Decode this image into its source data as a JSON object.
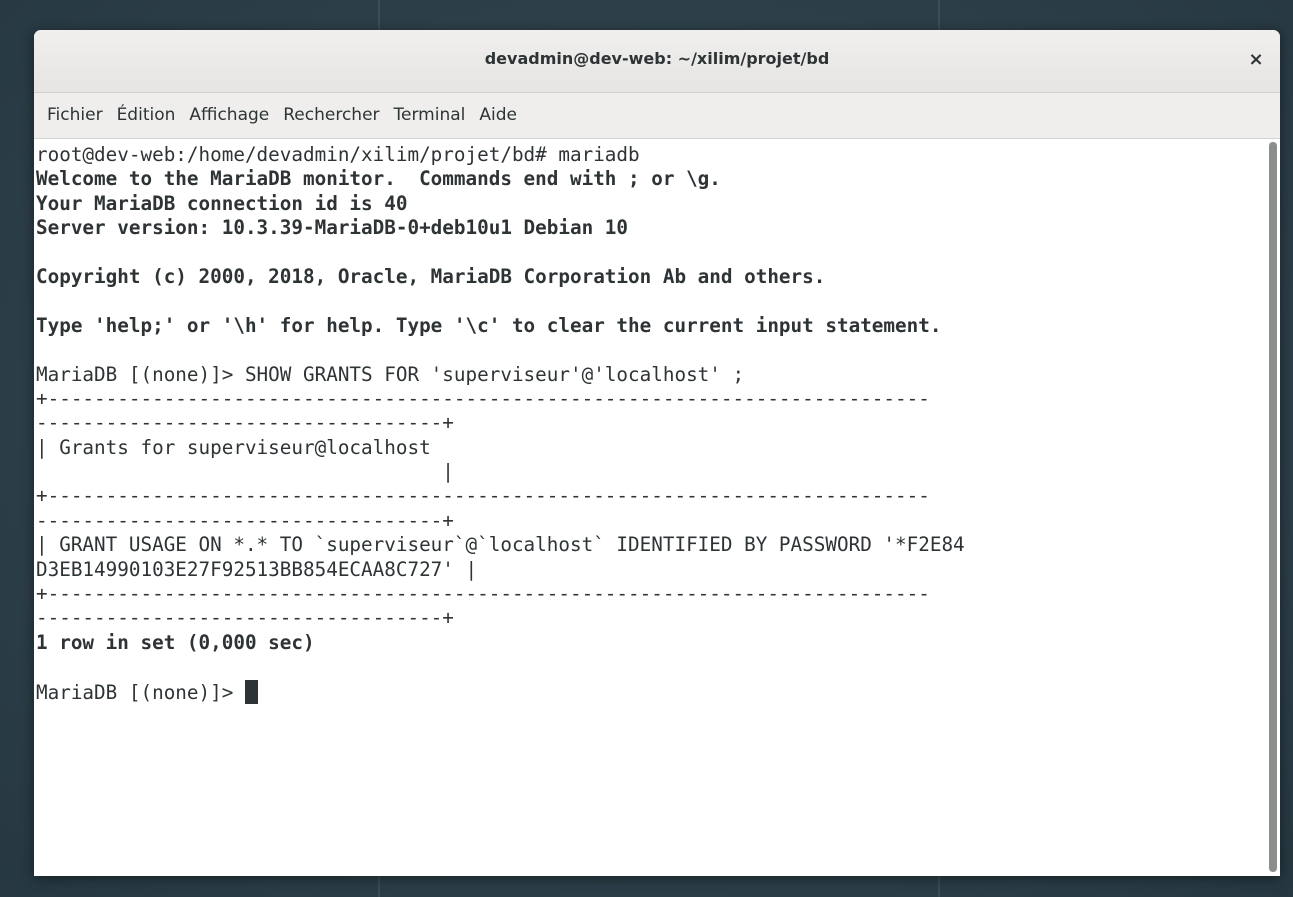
{
  "window": {
    "title": "devadmin@dev-web: ~/xilim/projet/bd",
    "close_glyph": "×"
  },
  "menu": {
    "items": [
      "Fichier",
      "Édition",
      "Affichage",
      "Rechercher",
      "Terminal",
      "Aide"
    ]
  },
  "terminal": {
    "lines": [
      {
        "text": "root@dev-web:/home/devadmin/xilim/projet/bd# mariadb",
        "bold": false
      },
      {
        "text": "Welcome to the MariaDB monitor.  Commands end with ; or \\g.",
        "bold": true
      },
      {
        "text": "Your MariaDB connection id is 40",
        "bold": true
      },
      {
        "text": "Server version: 10.3.39-MariaDB-0+deb10u1 Debian 10",
        "bold": true
      },
      {
        "text": "",
        "bold": false
      },
      {
        "text": "Copyright (c) 2000, 2018, Oracle, MariaDB Corporation Ab and others.",
        "bold": true
      },
      {
        "text": "",
        "bold": false
      },
      {
        "text": "Type 'help;' or '\\h' for help. Type '\\c' to clear the current input statement.",
        "bold": true
      },
      {
        "text": "",
        "bold": false
      },
      {
        "text": "MariaDB [(none)]> SHOW GRANTS FOR 'superviseur'@'localhost' ;",
        "bold": false
      },
      {
        "text": "+----------------------------------------------------------------------------",
        "bold": false
      },
      {
        "text": "-----------------------------------+",
        "bold": false
      },
      {
        "text": "| Grants for superviseur@localhost",
        "bold": false
      },
      {
        "text": "                                   |",
        "bold": false
      },
      {
        "text": "+----------------------------------------------------------------------------",
        "bold": false
      },
      {
        "text": "-----------------------------------+",
        "bold": false
      },
      {
        "text": "| GRANT USAGE ON *.* TO `superviseur`@`localhost` IDENTIFIED BY PASSWORD '*F2E84",
        "bold": false
      },
      {
        "text": "D3EB14990103E27F92513BB854ECAA8C727' |",
        "bold": false
      },
      {
        "text": "+----------------------------------------------------------------------------",
        "bold": false
      },
      {
        "text": "-----------------------------------+",
        "bold": false
      },
      {
        "text": "1 row in set (0,000 sec)",
        "bold": true
      },
      {
        "text": "",
        "bold": false
      }
    ],
    "prompt": "MariaDB [(none)]> "
  }
}
